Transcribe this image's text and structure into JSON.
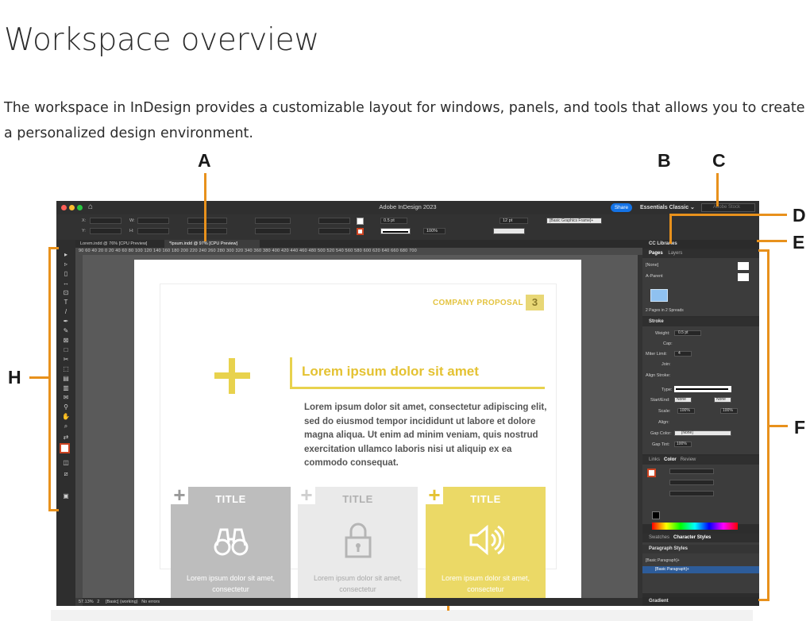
{
  "article": {
    "title": "Workspace overview",
    "intro": "The workspace in InDesign provides a customizable layout for windows, panels, and tools that allows you to create a personalized design environment."
  },
  "callouts": {
    "a": "A",
    "b": "B",
    "c": "C",
    "d": "D",
    "e": "E",
    "f": "F",
    "h": "H"
  },
  "app": {
    "window_title": "Adobe InDesign 2023",
    "share_label": "Share",
    "workspace_label": "Essentials Classic",
    "stock_placeholder": "Adobe Stock",
    "control": {
      "stroke_weight": "0.5 pt",
      "zoom": "100%",
      "font_size": "12 pt",
      "frame_style": "[Basic Graphics Frame]+",
      "x_label": "X:",
      "y_label": "Y:",
      "w_label": "W:",
      "h_label": "H:"
    },
    "doc_tabs": [
      "Lorem.indd @ 76% [CPU Preview]",
      "*Ipsum.indd @ 97% [CPU Preview]"
    ],
    "ruler_ticks": "90  60  40  20  0   20  40  60  80  100  120  140  160  180  200  220  240  260  280  300  320  340  360  380  400  420  440  460  480  500  520  540  560  580  600  620  640  660  680  700",
    "status": {
      "zoom": "57.13%",
      "page": "2",
      "style": "[Basic] (working)",
      "errors": "No errors"
    }
  },
  "document": {
    "company": "COMPANY PROPOSAL",
    "page_number": "3",
    "headline": "Lorem ipsum dolor sit amet",
    "body": "Lorem ipsum dolor sit amet, consectetur adipiscing elit, sed do eiusmod tempor incididunt ut labore et dolore magna aliqua. Ut enim ad minim veniam, quis nostrud exercitation ullamco laboris nisi ut aliquip ex ea commodo consequat.",
    "cards": [
      {
        "title": "TITLE",
        "text": "Lorem ipsum dolor sit amet, consectetur",
        "icon": "binoculars-icon",
        "color": "#bdbdbd"
      },
      {
        "title": "TITLE",
        "text": "Lorem ipsum dolor sit amet, consectetur",
        "icon": "lock-icon",
        "color": "#eaeaea"
      },
      {
        "title": "TITLE",
        "text": "Lorem ipsum dolor sit amet, consectetur",
        "icon": "speaker-icon",
        "color": "#ebd966"
      }
    ],
    "plus_glyph": "+"
  },
  "panels": {
    "cc_libraries": "CC Libraries",
    "pages_tab": "Pages",
    "layers_tab": "Layers",
    "none_label": "[None]",
    "a_parent": "A-Parent",
    "pages_summary": "2 Pages in 2 Spreads",
    "stroke": {
      "title": "Stroke",
      "weight_label": "Weight:",
      "weight": "0.5 pt",
      "cap_label": "Cap:",
      "miter_label": "Miter Limit:",
      "miter": "4",
      "join_label": "Join:",
      "align_label": "Align Stroke:",
      "type_label": "Type:",
      "start_end_label": "Start/End:",
      "start": "None",
      "end": "None",
      "scale_label": "Scale:",
      "scale_start": "100%",
      "scale_end": "100%",
      "align2_label": "Align:",
      "gap_color_label": "Gap Color:",
      "gap_color": "[None]",
      "gap_tint_label": "Gap Tint:",
      "gap_tint": "100%"
    },
    "color_tabs": [
      "Links",
      "Color",
      "Review"
    ],
    "style_tabs": [
      "Swatches",
      "Character Styles"
    ],
    "paragraph_styles": "Paragraph Styles",
    "basic_paragraph": "[Basic Paragraph]+",
    "basic_paragraph_selected": "[Basic Paragraph]+",
    "gradient": "Gradient"
  }
}
